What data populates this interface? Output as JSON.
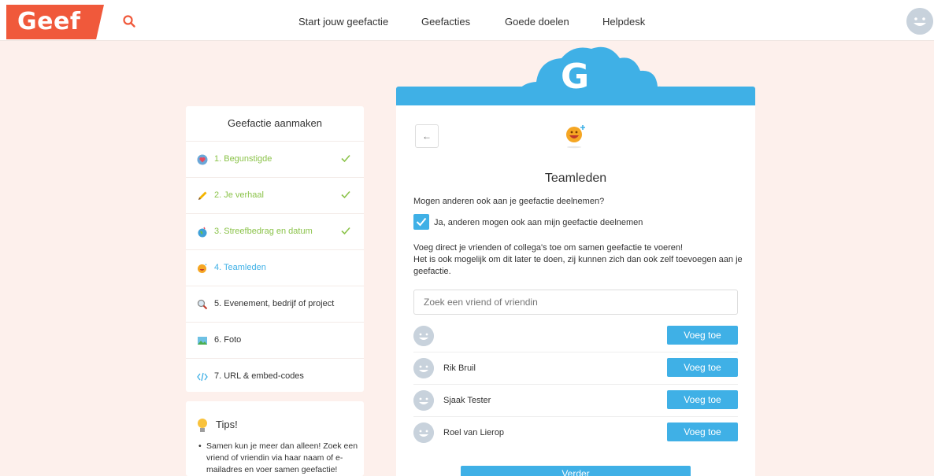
{
  "header": {
    "logo": "Geef",
    "nav": [
      "Start jouw geefactie",
      "Geefacties",
      "Goede doelen",
      "Helpdesk"
    ]
  },
  "sidebar": {
    "title": "Geefactie aanmaken",
    "steps": [
      {
        "label": "1. Begunstigde",
        "state": "done",
        "icon": "heart-icon"
      },
      {
        "label": "2. Je verhaal",
        "state": "done",
        "icon": "pencil-icon"
      },
      {
        "label": "3. Streefbedrag en datum",
        "state": "done",
        "icon": "globe-icon"
      },
      {
        "label": "4. Teamleden",
        "state": "active",
        "icon": "smiley-icon"
      },
      {
        "label": "5. Evenement, bedrijf of project",
        "state": "todo",
        "icon": "magnifier-icon"
      },
      {
        "label": "6. Foto",
        "state": "todo",
        "icon": "image-icon"
      },
      {
        "label": "7. URL & embed-codes",
        "state": "todo",
        "icon": "code-icon"
      }
    ]
  },
  "tips": {
    "title": "Tips!",
    "text": "Samen kun je meer dan alleen! Zoek een vriend of vriendin via haar naam of e-mailadres en voer samen geefactie!"
  },
  "card": {
    "badge": "G",
    "back_symbol": "←",
    "title": "Teamleden",
    "question": "Mogen anderen ook aan je geefactie deelnemen?",
    "checkbox_label": "Ja, anderen mogen ook aan mijn geefactie deelnemen",
    "checkbox_checked": true,
    "info_line1": "Voeg direct je vrienden of collega's toe om samen geefactie te voeren!",
    "info_line2": "Het is ook mogelijk om dit later te doen, zij kunnen zich dan ook zelf toevoegen aan je geefactie.",
    "search_placeholder": "Zoek een vriend of vriendin",
    "friends": [
      {
        "name": "",
        "button": "Voeg toe"
      },
      {
        "name": "Rik Bruil",
        "button": "Voeg toe"
      },
      {
        "name": "Sjaak Tester",
        "button": "Voeg toe"
      },
      {
        "name": "Roel van Lierop",
        "button": "Voeg toe"
      }
    ],
    "submit_label": "Verder"
  },
  "colors": {
    "brand": "#f0593b",
    "accent": "#3fb0e6",
    "done": "#8bc34a",
    "background": "#fdf0ec"
  }
}
